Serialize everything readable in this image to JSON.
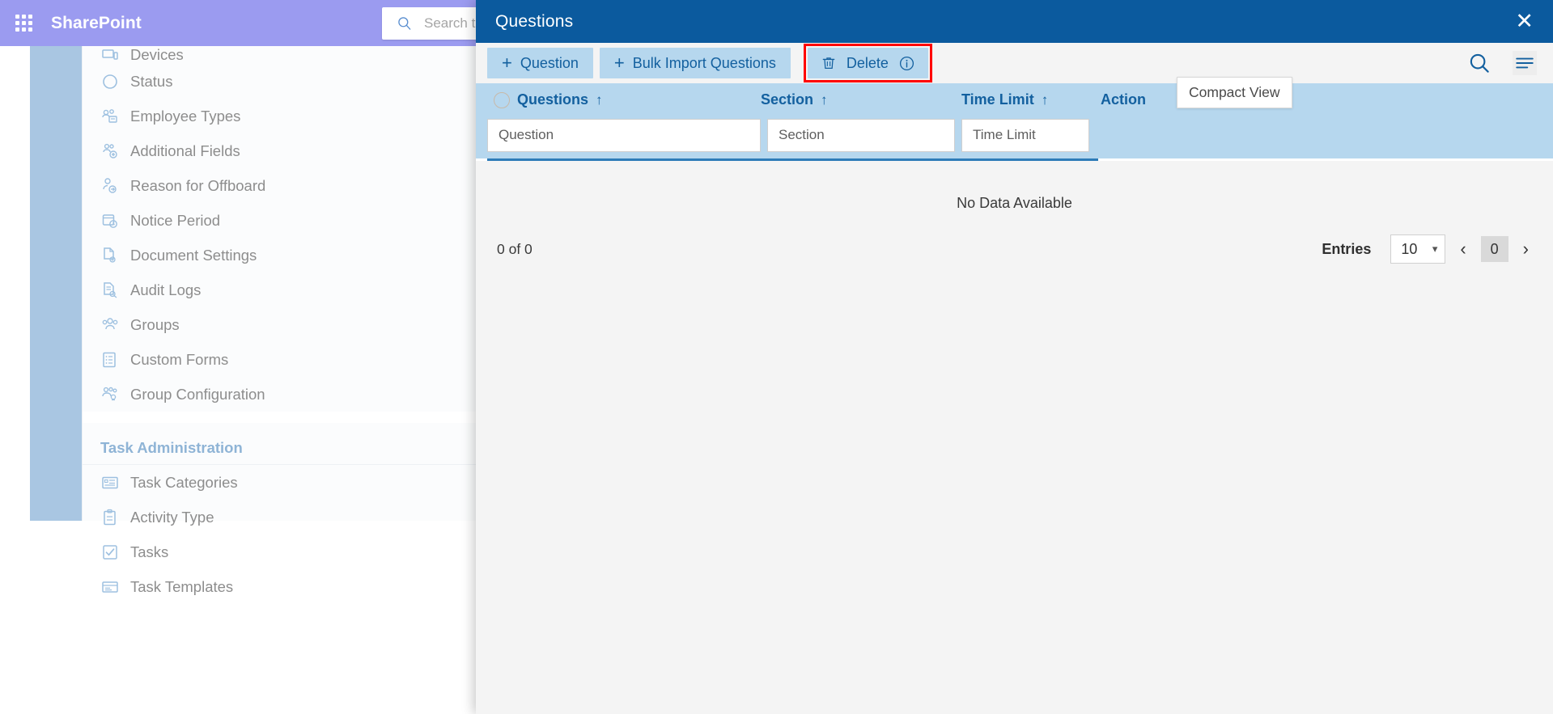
{
  "sp_header": {
    "app_launcher_icon": "waffle-grid-icon",
    "brand": "SharePoint",
    "search_icon": "search-icon",
    "search_placeholder": "Search this site",
    "search_value": ""
  },
  "sidebar": {
    "items": [
      {
        "label": "Devices",
        "icon": "device-icon"
      },
      {
        "label": "Status",
        "icon": "circle-icon"
      },
      {
        "label": "Employee Types",
        "icon": "people-badge-icon"
      },
      {
        "label": "Additional Fields",
        "icon": "people-add-icon"
      },
      {
        "label": "Reason for Offboard",
        "icon": "person-arrow-icon"
      },
      {
        "label": "Notice Period",
        "icon": "calendar-clock-icon"
      },
      {
        "label": "Document Settings",
        "icon": "document-gear-icon"
      },
      {
        "label": "Audit Logs",
        "icon": "document-search-icon"
      },
      {
        "label": "Groups",
        "icon": "people-group-icon"
      },
      {
        "label": "Custom Forms",
        "icon": "form-list-icon"
      },
      {
        "label": "Group Configuration",
        "icon": "people-settings-icon"
      }
    ],
    "group_title": "Task Administration",
    "task_items": [
      {
        "label": "Task Categories",
        "icon": "list-box-icon"
      },
      {
        "label": "Activity Type",
        "icon": "clipboard-icon"
      },
      {
        "label": "Tasks",
        "icon": "checkbox-icon"
      },
      {
        "label": "Task Templates",
        "icon": "template-icon"
      }
    ]
  },
  "modal": {
    "title": "Questions",
    "close_icon": "close-icon",
    "toolbar": {
      "add_question_label": "Question",
      "add_question_icon": "plus-icon",
      "bulk_import_label": "Bulk Import Questions",
      "bulk_import_icon": "plus-icon",
      "delete_label": "Delete",
      "delete_icon": "trash-icon",
      "delete_info_icon": "info-icon",
      "delete_highlight_color": "#ff0000",
      "search_icon": "search-icon",
      "list_view_icon": "hamburger-list-icon"
    },
    "table": {
      "select_all_icon": "circle-checkbox-icon",
      "sort_icon": "sort-ascending-arrow",
      "columns": [
        {
          "label": "Questions",
          "sort": "↑"
        },
        {
          "label": "Section",
          "sort": "↑"
        },
        {
          "label": "Time Limit",
          "sort": "↑"
        },
        {
          "label": "Action",
          "sort": ""
        }
      ],
      "filters": [
        {
          "placeholder": "Question",
          "value": ""
        },
        {
          "placeholder": "Section",
          "value": ""
        },
        {
          "placeholder": "Time Limit",
          "value": ""
        }
      ],
      "tooltip": "Compact View",
      "empty_message": "No Data Available"
    },
    "footer": {
      "count_text": "0 of 0",
      "entries_label": "Entries",
      "entries_value": "10",
      "entries_chevron_icon": "chevron-down-icon",
      "prev_icon": "‹",
      "page_current": "0",
      "next_icon": "›"
    }
  },
  "colors": {
    "sharepoint_purple": "#9b9bf0",
    "modal_header_blue": "#0b5a9e",
    "toolbar_button_blue": "#b6d7ee",
    "accent_text_blue": "#13609f",
    "highlight_red": "#ff0000"
  }
}
